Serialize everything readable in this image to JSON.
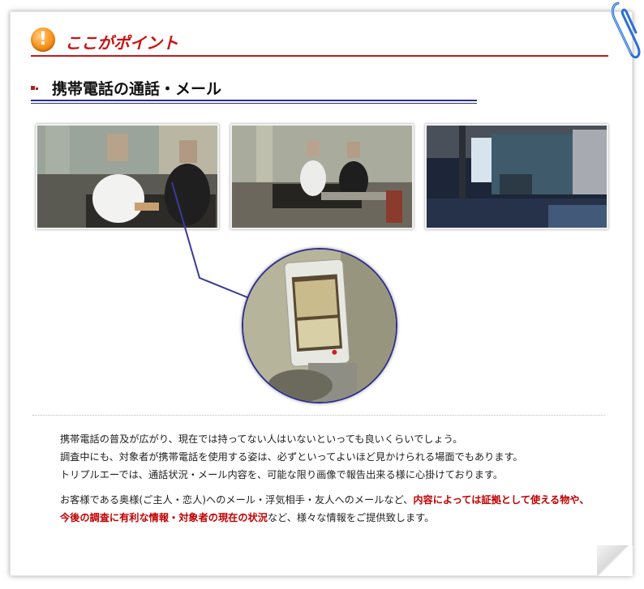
{
  "point": {
    "icon_glyph": "!",
    "title": "ここがポイント"
  },
  "section": {
    "title": "携帯電話の通話・メール"
  },
  "photos": [
    {
      "name": "surveillance-photo-1"
    },
    {
      "name": "surveillance-photo-2"
    },
    {
      "name": "surveillance-photo-3"
    }
  ],
  "paragraph1": {
    "line1": "携帯電話の普及が広がり、現在では持ってない人はいないといっても良いくらいでしょう。",
    "line2": "調査中にも、対象者が携帯電話を使用する姿は、必ずといってよいほど見かけられる場面でもあります。",
    "line3": "トリプルエーでは、通話状況・メール内容を、可能な限り画像で報告出来る様に心掛けております。"
  },
  "paragraph2": {
    "part1": "お客様である奥様(ご主人・恋人)へのメール・浮気相手・友人へのメールなど、",
    "part2_highlight": "内容によっては証拠として使える物や、今後の調査に有利な情報・対象者の現在の状況",
    "part3": "など、様々な情報をご提供致します。"
  },
  "colors": {
    "accent_red": "#c81414",
    "navy": "#2b2f82",
    "icon_orange": "#ff9a25"
  }
}
